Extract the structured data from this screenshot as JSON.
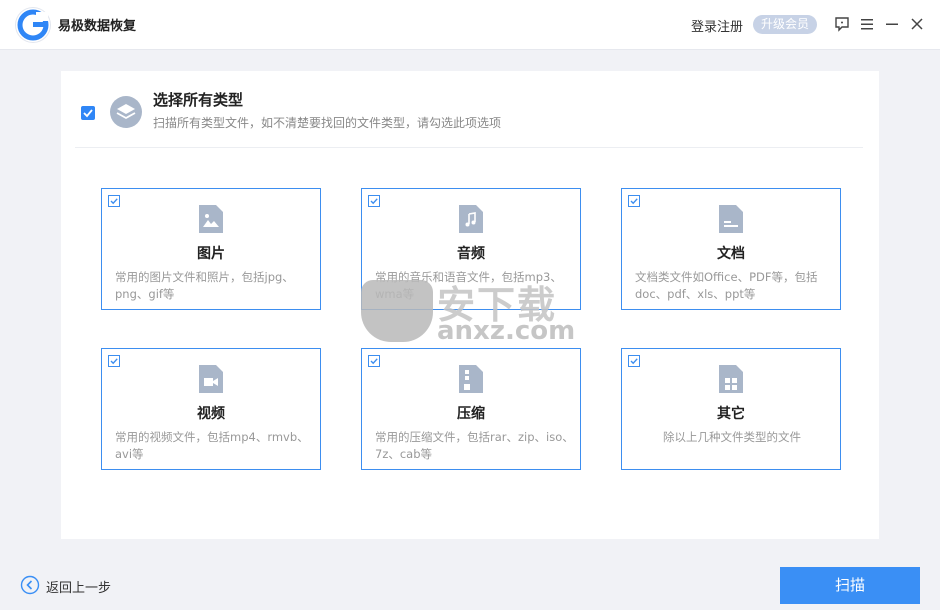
{
  "app": {
    "title": "易极数据恢复",
    "login_label": "登录注册",
    "vip_label": "升级会员"
  },
  "window_controls": {
    "icons": [
      "feedback-icon",
      "menu-icon",
      "minimize-icon",
      "close-icon"
    ]
  },
  "header": {
    "title": "选择所有类型",
    "description": "扫描所有类型文件，如不清楚要找回的文件类型，请勾选此项选项",
    "checked": true
  },
  "cards": [
    {
      "title": "图片",
      "desc": "常用的图片文件和照片，包括jpg、png、gif等",
      "icon": "image-file-icon",
      "checked": true
    },
    {
      "title": "音频",
      "desc": "常用的音乐和语音文件，包括mp3、wma等",
      "icon": "audio-file-icon",
      "checked": true
    },
    {
      "title": "文档",
      "desc": "文档类文件如Office、PDF等，包括doc、pdf、xls、ppt等",
      "icon": "document-file-icon",
      "checked": true
    },
    {
      "title": "视频",
      "desc": "常用的视频文件，包括mp4、rmvb、avi等",
      "icon": "video-file-icon",
      "checked": true
    },
    {
      "title": "压缩",
      "desc": "常用的压缩文件，包括rar、zip、iso、7z、cab等",
      "icon": "archive-file-icon",
      "checked": true
    },
    {
      "title": "其它",
      "desc": "除以上几种文件类型的文件",
      "icon": "other-file-icon",
      "checked": true
    }
  ],
  "watermark": {
    "text_cn": "安下载",
    "text_en": "anxz.com"
  },
  "footer": {
    "back_label": "返回上一步",
    "scan_label": "扫描"
  },
  "colors": {
    "accent": "#3a8ff5",
    "card_border": "#3d8ef0",
    "icon_fill": "#a9b6c9",
    "vip_bg": "#c7d2e6"
  }
}
